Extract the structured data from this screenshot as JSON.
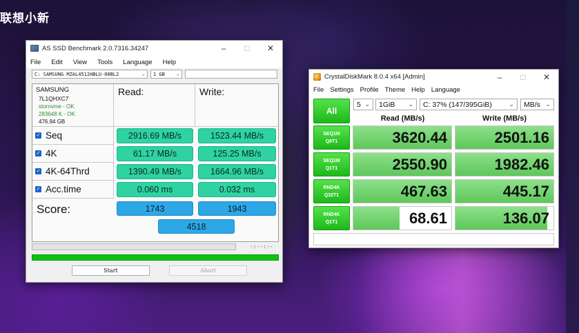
{
  "background": {
    "brand_text": "联想小新"
  },
  "asssd": {
    "title": "AS SSD Benchmark 2.0.7316.34247",
    "menu": [
      "File",
      "Edit",
      "View",
      "Tools",
      "Language",
      "Help"
    ],
    "drive_select": "C: SAMSUNG MZAL4512HBLU-00BL2",
    "size_select": "1 GB",
    "device": {
      "brand": "SAMSUNG",
      "model": "7L1QHXC7",
      "driver": "stornvme - OK",
      "alignment": "283648 K - OK",
      "capacity": "476.94 GB"
    },
    "headers": {
      "read": "Read:",
      "write": "Write:"
    },
    "rows": [
      {
        "label": "Seq",
        "read": "2916.69 MB/s",
        "write": "1523.44 MB/s",
        "checked": true
      },
      {
        "label": "4K",
        "read": "61.17 MB/s",
        "write": "125.25 MB/s",
        "checked": true
      },
      {
        "label": "4K-64Thrd",
        "read": "1390.49 MB/s",
        "write": "1664.96 MB/s",
        "checked": true
      },
      {
        "label": "Acc.time",
        "read": "0.060 ms",
        "write": "0.032 ms",
        "checked": true
      }
    ],
    "score_label": "Score:",
    "score_read": "1743",
    "score_write": "1943",
    "score_total": "4518",
    "elapsed": "-:--:--",
    "progress": 1.0,
    "start_label": "Start",
    "abort_label": "Abort",
    "colors": {
      "value_bg": "#2fd3a2",
      "score_bg": "#2ea7e6",
      "progress": "#10c010"
    }
  },
  "cdm": {
    "title": "CrystalDiskMark 8.0.4 x64 [Admin]",
    "menu": [
      "File",
      "Settings",
      "Profile",
      "Theme",
      "Help",
      "Language"
    ],
    "all_label": "All",
    "runs": "5",
    "size": "1GiB",
    "drive": "C: 37% (147/395GiB)",
    "unit": "MB/s",
    "read_header": "Read (MB/s)",
    "write_header": "Write (MB/s)",
    "tests": [
      {
        "l1": "SEQ1M",
        "l2": "Q8T1",
        "read": "3620.44",
        "write": "2501.16",
        "read_fill": 1.0,
        "write_fill": 1.0
      },
      {
        "l1": "SEQ1M",
        "l2": "Q1T1",
        "read": "2550.90",
        "write": "1982.46",
        "read_fill": 1.0,
        "write_fill": 1.0
      },
      {
        "l1": "RND4K",
        "l2": "Q32T1",
        "read": "467.63",
        "write": "445.17",
        "read_fill": 1.0,
        "write_fill": 1.0
      },
      {
        "l1": "RND4K",
        "l2": "Q1T1",
        "read": "68.61",
        "write": "136.07",
        "read_fill": 0.47,
        "write_fill": 0.94
      }
    ],
    "colors": {
      "accent": "#1db81a",
      "bar": "#5ec75a"
    }
  }
}
